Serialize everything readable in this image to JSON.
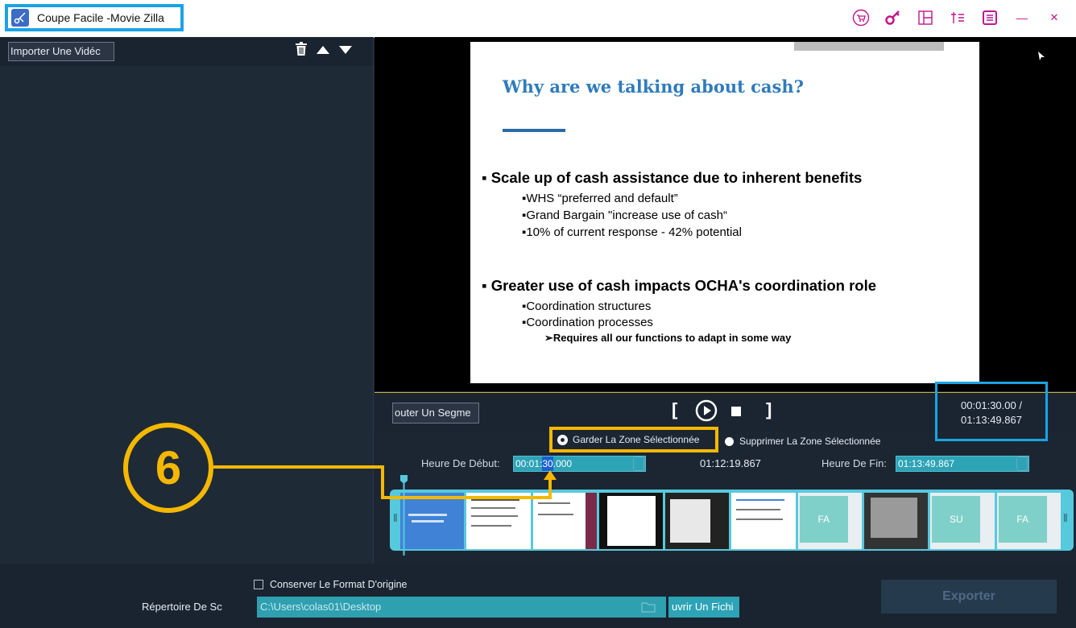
{
  "window": {
    "title": "Coupe Facile -Movie Zilla",
    "titlebar_icons": [
      "cart-icon",
      "key-icon",
      "layout-icon",
      "list-icon",
      "menu-icon",
      "minimize-icon",
      "close-icon"
    ],
    "minimize_glyph": "—",
    "close_glyph": "✕"
  },
  "left_panel": {
    "import_button": "Importer Une Vidéc"
  },
  "slide": {
    "title": "Why are we talking about cash?",
    "bullet1": "▪ Scale up of cash assistance due to inherent benefits",
    "sub1": [
      "▪WHS “preferred and default”",
      "▪Grand Bargain \"increase use of cash“",
      "▪10% of current response - 42% potential"
    ],
    "bullet2": "▪ Greater use of cash impacts OCHA's coordination role",
    "sub2": [
      "▪Coordination structures",
      "▪Coordination processes"
    ],
    "sub3": "➢Requires all our functions to adapt in some way"
  },
  "controls": {
    "segment_button": "outer Un Segme",
    "bracket_open": "[",
    "bracket_close": "]",
    "time_current": "00:01:30.00 /",
    "time_total": "01:13:49.867"
  },
  "modes": {
    "keep": "Garder La Zone Sélectionnée",
    "delete": "Supprimer La Zone Sélectionnée"
  },
  "range": {
    "start_label": "Heure De Début:",
    "start_value_pre": "00:01:",
    "start_value_sel": "30",
    "start_value_post": ".000",
    "duration": "01:12:19.867",
    "end_label": "Heure De Fin:",
    "end_value": "01:13:49.867"
  },
  "annotation": {
    "step": "6",
    "color": "#f5b800"
  },
  "bottom": {
    "keep_format_label": "Conserver Le Format D'origine",
    "dir_label": "Répertoire De Sc",
    "dir_value": "C:\\Users\\colas01\\Desktop",
    "open_button": "uvrir Un Fichi",
    "export_button": "Exporter"
  },
  "thumbnails": [
    "slide",
    "doc",
    "doc",
    "doc-dark",
    "dark",
    "doc",
    "slide-fa",
    "dark-doc",
    "slide-su",
    "slide-fa"
  ],
  "colors": {
    "accent_blue": "#1aa3e6",
    "teal": "#2da3b6",
    "brand_magenta": "#c0178c"
  }
}
